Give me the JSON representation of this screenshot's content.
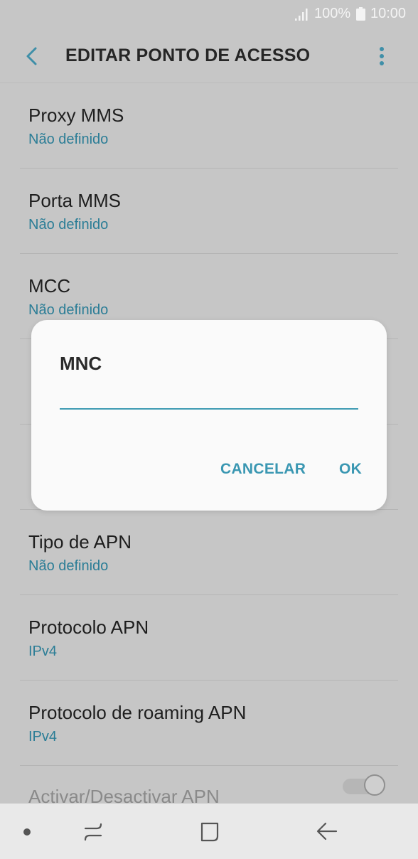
{
  "status_bar": {
    "battery_pct": "100%",
    "time": "10:00"
  },
  "app_bar": {
    "title": "EDITAR PONTO DE ACESSO"
  },
  "settings": [
    {
      "label": "Proxy MMS",
      "value": "Não definido"
    },
    {
      "label": "Porta MMS",
      "value": "Não definido"
    },
    {
      "label": "MCC",
      "value": "Não definido"
    },
    {
      "label": "",
      "value": ""
    },
    {
      "label": "",
      "value": ""
    },
    {
      "label": "Tipo de APN",
      "value": "Não definido"
    },
    {
      "label": "Protocolo APN",
      "value": "IPv4"
    },
    {
      "label": "Protocolo de roaming APN",
      "value": "IPv4"
    },
    {
      "label": "Activar/Desactivar APN",
      "value": ""
    }
  ],
  "dialog": {
    "title": "MNC",
    "input_value": "",
    "cancel_label": "CANCELAR",
    "ok_label": "OK"
  },
  "colors": {
    "accent": "#3a97b2",
    "value_text": "#2b7d96"
  }
}
